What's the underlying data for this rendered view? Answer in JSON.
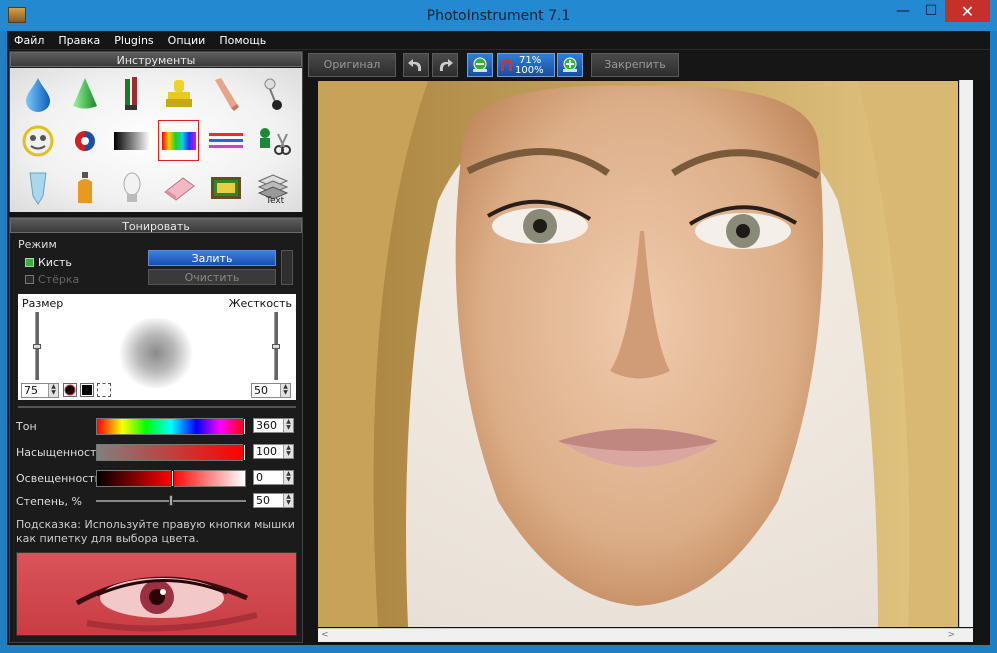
{
  "window": {
    "title": "PhotoInstrument 7.1",
    "min_symbol": "—",
    "max_symbol": "☐",
    "close_symbol": "✕"
  },
  "menu": [
    "Файл",
    "Правка",
    "Plugins",
    "Опции",
    "Помощь"
  ],
  "tools_panel": {
    "title": "Инструменты",
    "icons": [
      "water-drop-icon",
      "cone-icon",
      "brushes-icon",
      "stamp-icon",
      "eraser-finger-icon",
      "pin-icon",
      "mask-icon",
      "eye-contrast-icon",
      "gradient-icon",
      "rainbow-gradient-icon",
      "color-lines-icon",
      "clone-scissors-icon",
      "tube-icon",
      "bottle-icon",
      "bulb-icon",
      "eraser-icon",
      "tv-icon",
      "text-stack-icon"
    ],
    "selected_index": 9
  },
  "tone_panel": {
    "title": "Тонировать",
    "mode_label": "Режим",
    "brush_option": "Кисть",
    "eraser_option": "Стёрка",
    "fill_button": "Залить",
    "clear_button": "Очистить",
    "size_label": "Размер",
    "hardness_label": "Жесткость",
    "size_value": "75",
    "hardness_value": "50",
    "size_level": 0.5,
    "hardness_level": 0.5,
    "hue_label": "Тон",
    "hue_value": "360",
    "saturation_label": "Насыщенность",
    "saturation_value": "100",
    "lightness_label": "Освещенность",
    "lightness_value": "0",
    "degree_label": "Степень, %",
    "degree_value": "50",
    "hint_text": "Подсказка: Используйте правую кнопки мышки как пипетку для выбора цвета."
  },
  "toolbar": {
    "original_button": "Оригинал",
    "zoom_top": "71%",
    "zoom_bottom": "100%",
    "pin_button": "Закрепить"
  },
  "canvas": {
    "scroll_left": "<",
    "scroll_right": ">"
  }
}
